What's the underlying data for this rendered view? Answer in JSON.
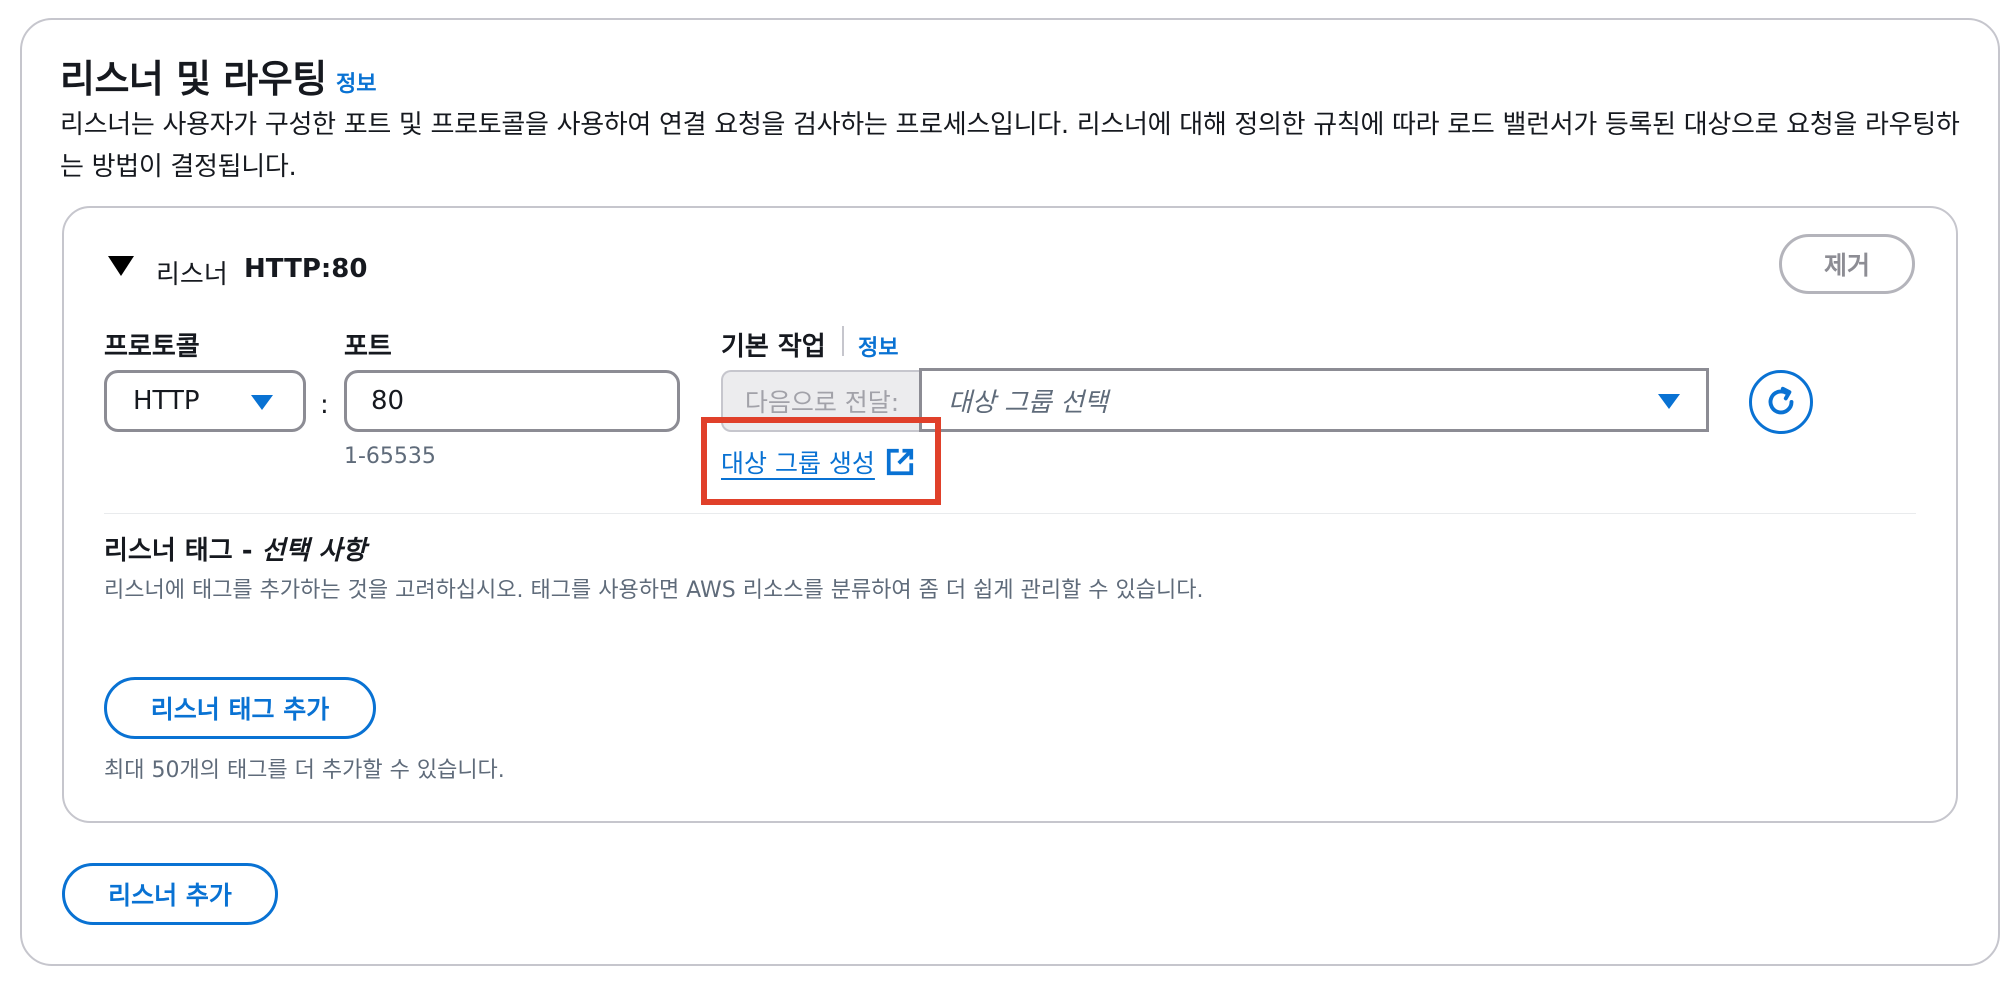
{
  "section": {
    "title": "리스너 및 라우팅",
    "info": "정보",
    "description": "리스너는 사용자가 구성한 포트 및 프로토콜을 사용하여 연결 요청을 검사하는 프로세스입니다. 리스너에 대해 정의한 규칙에 따라 로드 밸런서가 등록된 대상으로 요청을 라우팅하는 방법이 결정됩니다."
  },
  "listener": {
    "label": "리스너",
    "name": "HTTP:80",
    "remove_label": "제거",
    "protocol_label": "프로토콜",
    "protocol_value": "HTTP",
    "colon": ":",
    "port_label": "포트",
    "port_value": "80",
    "port_hint": "1-65535",
    "action_label": "기본 작업",
    "action_info": "정보",
    "forward_prefix": "다음으로 전달:",
    "target_placeholder": "대상 그룹 선택",
    "create_target_link": "대상 그룹 생성",
    "tags": {
      "title": "리스너 태그 - ",
      "title_optional": "선택 사항",
      "description": "리스너에 태그를 추가하는 것을 고려하십시오. 태그를 사용하면 AWS 리소스를 분류하여 좀 더 쉽게 관리할 수 있습니다.",
      "add_label": "리스너 태그 추가",
      "hint": "최대 50개의 태그를 더 추가할 수 있습니다."
    }
  },
  "add_listener_label": "리스너 추가",
  "icons": {
    "expand": "caret-down-icon",
    "dropdown": "triangle-down-icon",
    "refresh": "refresh-icon",
    "external": "external-link-icon"
  },
  "colors": {
    "accent": "#0972d3",
    "highlight": "#e0402a",
    "border": "#8c8c94"
  }
}
